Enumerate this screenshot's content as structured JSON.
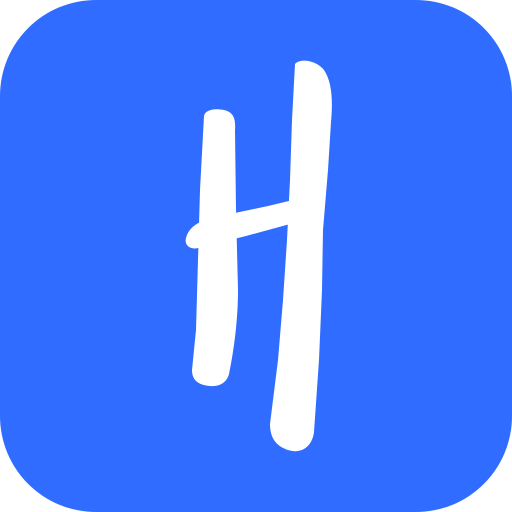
{
  "app_icon": {
    "icon": "brush-letter-h-icon",
    "letter": "H",
    "background_color": "#2f6cff",
    "glyph_color": "#ffffff"
  }
}
